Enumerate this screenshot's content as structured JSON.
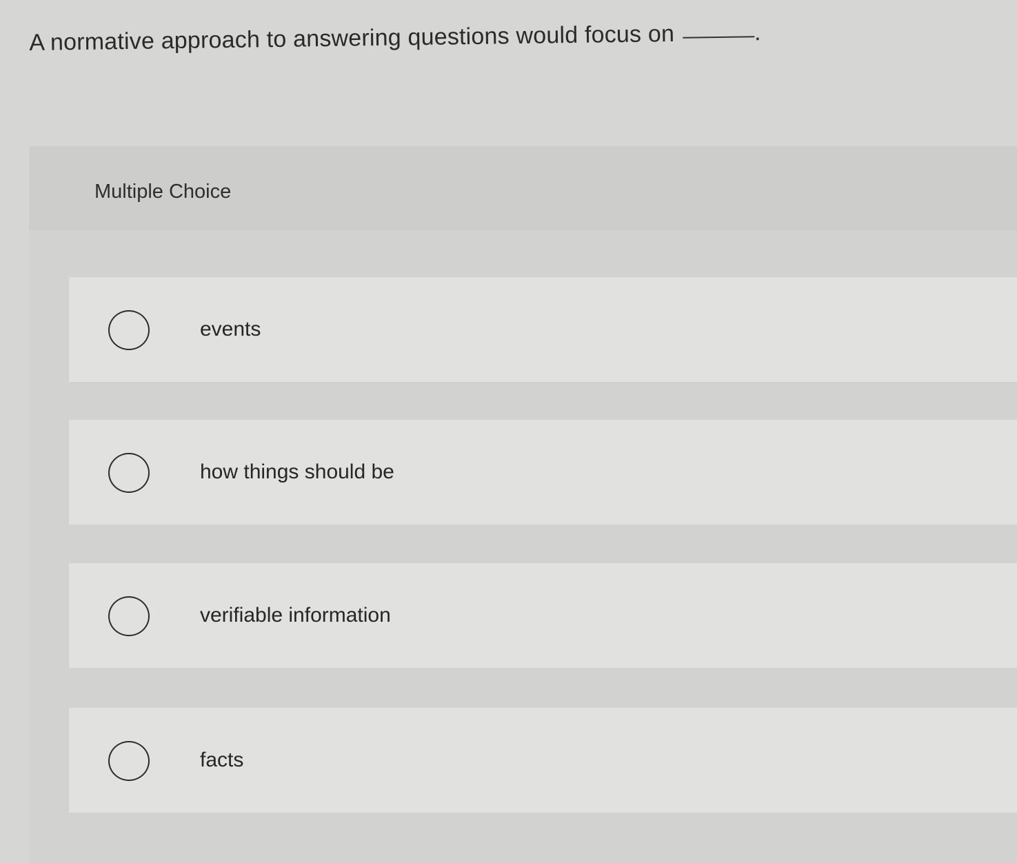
{
  "question": {
    "text": "A normative approach to answering questions would focus on",
    "end_punctuation": "."
  },
  "multiple_choice": {
    "label": "Multiple Choice",
    "options": [
      {
        "label": "events"
      },
      {
        "label": "how things should be"
      },
      {
        "label": "verifiable information"
      },
      {
        "label": "facts"
      }
    ]
  }
}
